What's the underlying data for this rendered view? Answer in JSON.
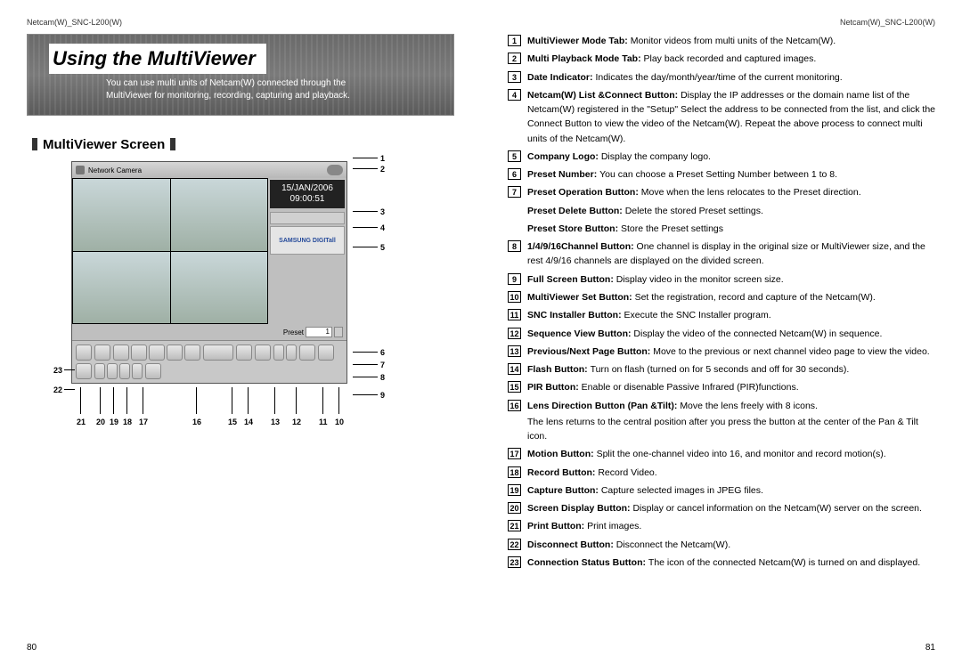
{
  "header": {
    "left": "Netcam(W)_SNC-L200(W)",
    "right": "Netcam(W)_SNC-L200(W)"
  },
  "banner": {
    "title": "Using the MultiViewer",
    "desc1": "You can use multi units of Netcam(W) connected through the",
    "desc2": "MultiViewer for monitoring, recording, capturing and playback."
  },
  "section_title": "MultiViewer Screen",
  "viewer": {
    "titlebar": "Network Camera",
    "date": "15/JAN/2006",
    "time": "09:00:51",
    "logo": "SAMSUNG DIGITall",
    "preset_label": "Preset",
    "preset_value": "1"
  },
  "callouts": {
    "right": [
      "1",
      "2",
      "3",
      "4",
      "5",
      "6",
      "7",
      "8",
      "9"
    ],
    "left": [
      "23",
      "22"
    ],
    "bottom": [
      "21",
      "20",
      "19",
      "18",
      "17",
      "16",
      "15",
      "14",
      "13",
      "12",
      "11",
      "10"
    ]
  },
  "items": [
    {
      "n": "1",
      "title": "MultiViewer Mode Tab:",
      "text": "Monitor videos from multi units of the Netcam(W)."
    },
    {
      "n": "2",
      "title": "Multi Playback Mode Tab:",
      "text": "Play back recorded and captured images."
    },
    {
      "n": "3",
      "title": "Date Indicator:",
      "text": "Indicates the day/month/year/time of the current monitoring."
    },
    {
      "n": "4",
      "title": "Netcam(W) List &Connect Button:",
      "text": "Display the IP addresses or the domain name list of the Netcam(W) registered in the \"Setup\" Select the address to be connected from the list, and click the Connect Button to view the video of the Netcam(W). Repeat the above process to connect multi units of the Netcam(W)."
    },
    {
      "n": "5",
      "title": "Company Logo:",
      "text": "Display the company logo."
    },
    {
      "n": "6",
      "title": "Preset Number:",
      "text": "You can choose a Preset Setting Number between 1 to 8."
    },
    {
      "n": "7",
      "title": "Preset Operation Button:",
      "text": "Move when the lens relocates to the Preset direction."
    },
    {
      "n": "",
      "title": "Preset Delete Button:",
      "text": "Delete the stored Preset settings."
    },
    {
      "n": "",
      "title": "Preset Store Button:",
      "text": "Store the Preset settings"
    },
    {
      "n": "8",
      "title": "1/4/9/16Channel Button:",
      "text": "One channel is display in the original size or MultiViewer size, and the rest 4/9/16 channels are displayed on the divided screen."
    },
    {
      "n": "9",
      "title": "Full Screen Button:",
      "text": "Display video in the monitor screen size."
    },
    {
      "n": "10",
      "title": "MultiViewer Set Button:",
      "text": "Set the registration, record and capture of the Netcam(W)."
    },
    {
      "n": "11",
      "title": "SNC Installer Button:",
      "text": "Execute the SNC Installer program."
    },
    {
      "n": "12",
      "title": "Sequence View Button:",
      "text": "Display the video of the connected Netcam(W) in sequence."
    },
    {
      "n": "13",
      "title": "Previous/Next Page Button:",
      "text": "Move to the previous or next channel video page to view the video."
    },
    {
      "n": "14",
      "title": "Flash Button:",
      "text": "Turn on flash (turned on for 5 seconds and off for 30 seconds)."
    },
    {
      "n": "15",
      "title": "PIR Button:",
      "text": "Enable or disenable Passive Infrared (PIR)functions."
    },
    {
      "n": "16",
      "title": "Lens Direction Button (Pan &Tilt):",
      "text": "Move the lens freely with 8 icons.",
      "sub": "The lens returns to the central position after you press the button at the center of the Pan & Tilt icon."
    },
    {
      "n": "17",
      "title": "Motion Button:",
      "text": "Split the one-channel video into 16, and monitor and record motion(s)."
    },
    {
      "n": "18",
      "title": "Record Button:",
      "text": "Record Video."
    },
    {
      "n": "19",
      "title": "Capture Button:",
      "text": "Capture selected images in JPEG files."
    },
    {
      "n": "20",
      "title": "Screen Display Button:",
      "text": "Display or cancel information on the Netcam(W) server on the screen."
    },
    {
      "n": "21",
      "title": "Print Button:",
      "text": "Print images."
    },
    {
      "n": "22",
      "title": "Disconnect Button:",
      "text": "Disconnect the Netcam(W)."
    },
    {
      "n": "23",
      "title": "Connection Status Button:",
      "text": "The icon of the connected Netcam(W) is turned on and displayed."
    }
  ],
  "page_numbers": {
    "left": "80",
    "right": "81"
  }
}
